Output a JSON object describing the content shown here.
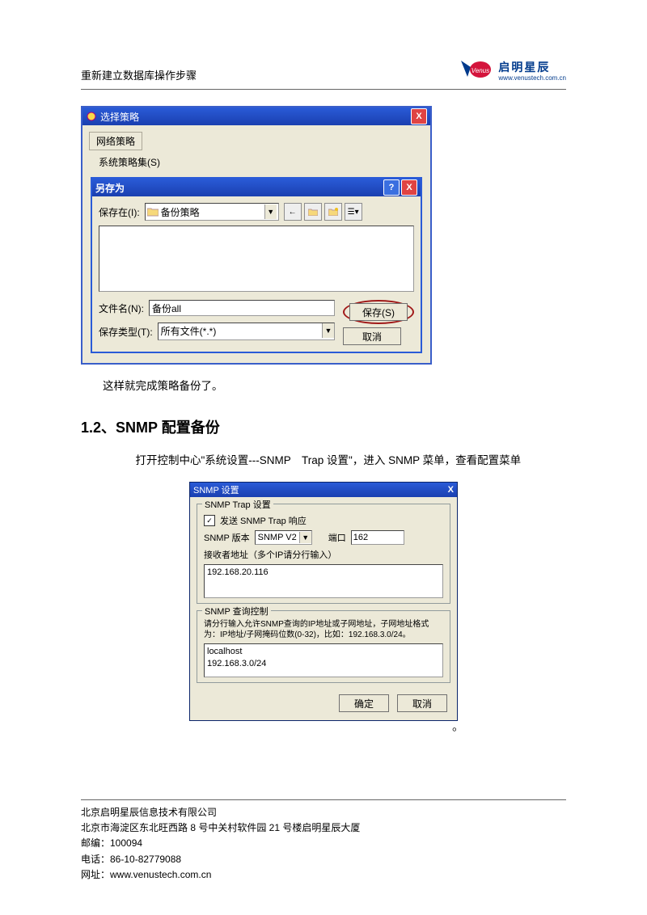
{
  "header": {
    "title": "重新建立数据库操作步骤",
    "logo_name": "启明星辰",
    "logo_url": "www.venustech.com.cn"
  },
  "policy_window": {
    "title": "选择策略",
    "tab": "网络策略",
    "menu_item": "系统策略集(S)"
  },
  "save_dialog": {
    "title": "另存为",
    "help_glyph": "?",
    "close_glyph": "X",
    "save_in_label": "保存在(I):",
    "folder_name": "备份策略",
    "filename_label": "文件名(N):",
    "filename_value": "备份all",
    "filetype_label": "保存类型(T):",
    "filetype_value": "所有文件(*.*)",
    "save_btn": "保存(S)",
    "cancel_btn": "取消"
  },
  "body_text_1": "这样就完成策略备份了。",
  "section_heading": "1.2、SNMP 配置备份",
  "body_text_2": "打开控制中心\"系统设置---SNMP　Trap 设置\"，进入 SNMP 菜单，查看配置菜单",
  "snmp_window": {
    "title": "SNMP 设置",
    "group1": {
      "title": "SNMP Trap 设置",
      "checkbox_label": "发送 SNMP Trap 响应",
      "checked_glyph": "✓",
      "version_label": "SNMP 版本",
      "version_value": "SNMP V2",
      "port_label": "端口",
      "port_value": "162",
      "receiver_label": "接收者地址（多个IP请分行输入）",
      "receiver_value": "192.168.20.116"
    },
    "group2": {
      "title": "SNMP 查询控制",
      "hint": "请分行输入允许SNMP查询的IP地址或子网地址，子网地址格式为：IP地址/子网掩码位数(0-32)，比如：192.168.3.0/24。",
      "value": "localhost\n192.168.3.0/24"
    },
    "ok_btn": "确定",
    "cancel_btn": "取消"
  },
  "footer": {
    "line1": "北京启明星辰信息技术有限公司",
    "line2": "北京市海淀区东北旺西路 8 号中关村软件园 21 号楼启明星辰大厦",
    "line3": "邮编：100094",
    "line4": "电话：86-10-82779088",
    "line5": "网址：www.venustech.com.cn"
  }
}
